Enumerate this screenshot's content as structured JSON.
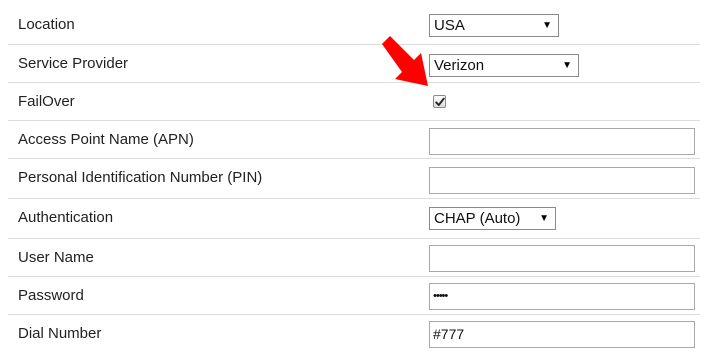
{
  "form": {
    "location": {
      "label": "Location",
      "value": "USA"
    },
    "service_provider": {
      "label": "Service Provider",
      "value": "Verizon"
    },
    "failover": {
      "label": "FailOver",
      "checked": true
    },
    "apn": {
      "label": "Access Point Name (APN)",
      "value": ""
    },
    "pin": {
      "label": "Personal Identification Number (PIN)",
      "value": ""
    },
    "authentication": {
      "label": "Authentication",
      "value": "CHAP (Auto)"
    },
    "user_name": {
      "label": "User Name",
      "value": ""
    },
    "password": {
      "label": "Password",
      "value": "•••••"
    },
    "dial_number": {
      "label": "Dial Number",
      "value": "#777"
    }
  },
  "icons": {
    "dropdown": "caret-down-icon",
    "check": "checkmark-icon",
    "pointer": "red-arrow-icon"
  },
  "colors": {
    "pointer_arrow": "#ff0000",
    "row_divider": "#dddddd"
  }
}
